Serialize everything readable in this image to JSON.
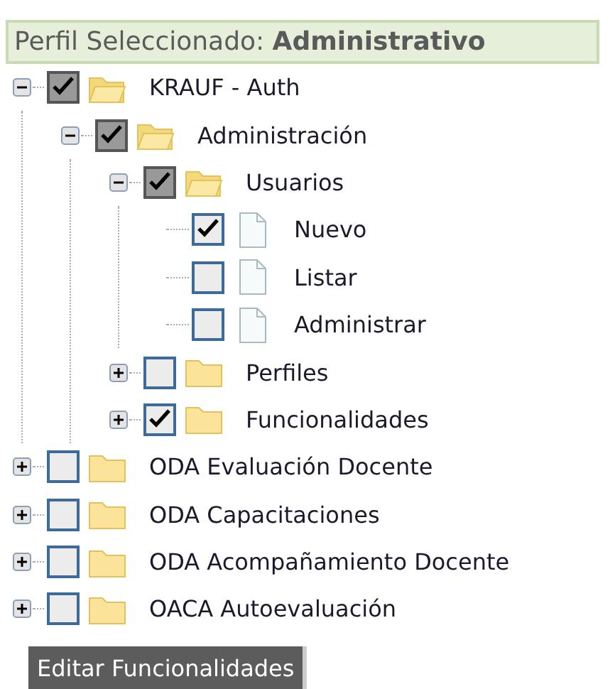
{
  "header": {
    "text": "Perfil Seleccionado: **Administrativo**"
  },
  "tree": [
    {
      "kind": "folder",
      "label": "KRAUF - Auth",
      "expanded": true,
      "checked": true,
      "partial": true,
      "children": [
        {
          "kind": "folder",
          "label": "Administración",
          "expanded": true,
          "checked": true,
          "partial": true,
          "children": [
            {
              "kind": "folder",
              "label": "Usuarios",
              "expanded": true,
              "checked": true,
              "partial": true,
              "children": [
                {
                  "kind": "page",
                  "label": "Nuevo",
                  "checked": true,
                  "partial": false
                },
                {
                  "kind": "page",
                  "label": "Listar",
                  "checked": false,
                  "partial": false
                },
                {
                  "kind": "page",
                  "label": "Administrar",
                  "checked": false,
                  "partial": false
                }
              ]
            },
            {
              "kind": "folder",
              "label": "Perfiles",
              "expanded": false,
              "checked": false,
              "partial": false
            },
            {
              "kind": "folder",
              "label": "Funcionalidades",
              "expanded": false,
              "checked": true,
              "partial": false
            }
          ]
        }
      ]
    },
    {
      "kind": "folder",
      "label": "ODA Evaluación Docente",
      "expanded": false,
      "checked": false,
      "partial": false
    },
    {
      "kind": "folder",
      "label": "ODA Capacitaciones",
      "expanded": false,
      "checked": false,
      "partial": false
    },
    {
      "kind": "folder",
      "label": "ODA Acompañamiento Docente",
      "expanded": false,
      "checked": false,
      "partial": false
    },
    {
      "kind": "folder",
      "label": "OACA Autoevaluación",
      "expanded": false,
      "checked": false,
      "partial": false
    }
  ],
  "button": {
    "label": "Editar Funcionalidades"
  }
}
